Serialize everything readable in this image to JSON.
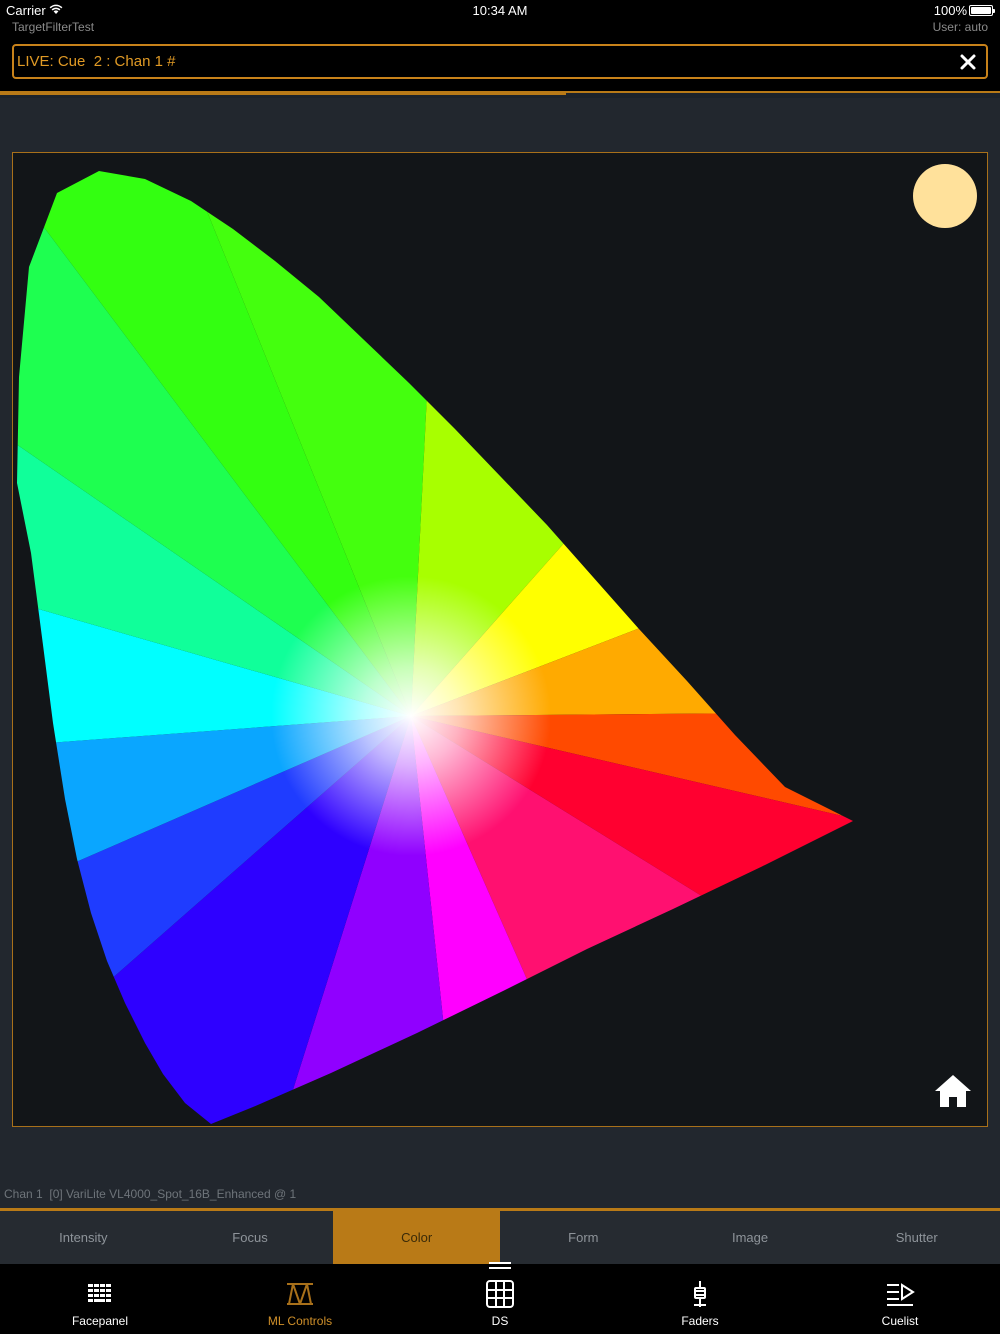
{
  "status": {
    "carrier": "Carrier",
    "app_name": "TargetFilterTest",
    "time": "10:34 AM",
    "battery_pct": "100%",
    "battery_level": 1.0,
    "user": "User: auto"
  },
  "command_line": {
    "text": "LIVE: Cue  2 : Chan 1 #",
    "clear_icon": "close-icon"
  },
  "progress": 0.566,
  "color_picker": {
    "current_color": "#ffe19b",
    "home_icon": "home-icon"
  },
  "channel_info": "Chan 1  [0] VariLite VL4000_Spot_16B_Enhanced @ 1",
  "attribute_tabs": [
    {
      "label": "Intensity",
      "active": false
    },
    {
      "label": "Focus",
      "active": false
    },
    {
      "label": "Color",
      "active": true
    },
    {
      "label": "Form",
      "active": false
    },
    {
      "label": "Image",
      "active": false
    },
    {
      "label": "Shutter",
      "active": false
    }
  ],
  "bottom_nav": [
    {
      "label": "Facepanel",
      "icon": "facepanel-icon",
      "active": false
    },
    {
      "label": "ML Controls",
      "icon": "ml-controls-icon",
      "active": true
    },
    {
      "label": "DS",
      "icon": "ds-grid-icon",
      "active": false
    },
    {
      "label": "Faders",
      "icon": "faders-icon",
      "active": false
    },
    {
      "label": "Cuelist",
      "icon": "cuelist-icon",
      "active": false
    }
  ],
  "colors": {
    "accent": "#b97a17",
    "accent_text": "#e09a25",
    "background": "#22272e"
  }
}
